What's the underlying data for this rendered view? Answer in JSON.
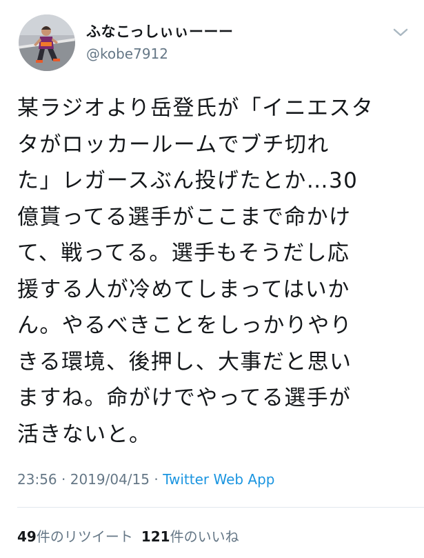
{
  "user": {
    "display_name": "ふなこっしぃぃーーー",
    "handle": "@kobe7912"
  },
  "tweet": {
    "lines": [
      "某ラジオより岳登氏が「イニエスタ",
      "タがロッカールームでブチ切れ",
      "た」レガースぶん投げたとか…30",
      "億貰ってる選手がここまで命かけ",
      "て、戦ってる。選手もそうだし応",
      "援する人が冷めてしまってはいか",
      "ん。やるべきことをしっかりやり",
      "きる環境、後押し、大事だと思い",
      "ますね。命がけでやってる選手が",
      "活きないと。"
    ]
  },
  "meta": {
    "time": "23:56",
    "separator1": " · ",
    "date": "2019/04/15",
    "separator2": " · ",
    "source": "Twitter Web App"
  },
  "stats": {
    "retweets_count": "49",
    "retweets_label": "件のリツイート",
    "likes_count": "121",
    "likes_label": "件のいいね"
  },
  "colors": {
    "text": "#14171a",
    "secondary": "#657786",
    "link": "#1b95e0",
    "divider": "#e1e8ed"
  },
  "icons": {
    "menu": "chevron-down-icon",
    "avatar": "runner-photo"
  }
}
